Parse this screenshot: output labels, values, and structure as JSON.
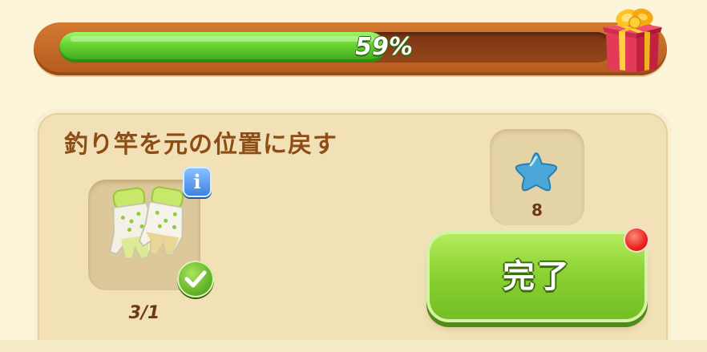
{
  "progress": {
    "percent_label": "59%",
    "value": 0.59,
    "fill_color": "#5ec72a",
    "track_color": "#8a3f18"
  },
  "reward_gift": {
    "icon": "gift-box-icon"
  },
  "task": {
    "title": "釣り竿を元の位置に戻す",
    "item": {
      "icon": "gloves-icon",
      "count": "3/1",
      "completed_icon": "checkmark-icon",
      "info_label": "i"
    },
    "reward": {
      "icon": "blue-star-icon",
      "amount": "8"
    }
  },
  "complete_button": {
    "label": "完了",
    "color": "#8cd334",
    "has_notification": true
  }
}
